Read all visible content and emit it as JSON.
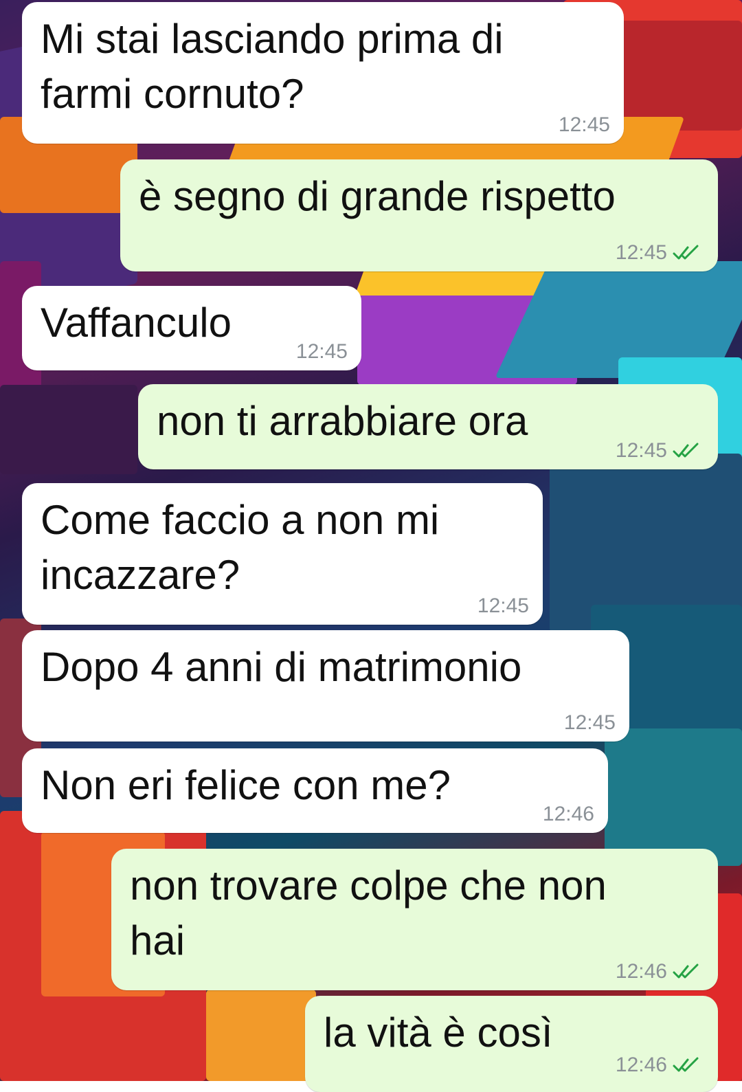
{
  "messages": [
    {
      "direction": "in",
      "text": "Mi stai lasciando prima di\nfarmi cornuto?",
      "time": "12:45"
    },
    {
      "direction": "out",
      "text": "è segno di grande rispetto",
      "time": "12:45",
      "status_icon": "double-check-icon"
    },
    {
      "direction": "in",
      "text": "Vaffanculo",
      "time": "12:45"
    },
    {
      "direction": "out",
      "text": "non ti arrabbiare ora",
      "time": "12:45",
      "status_icon": "double-check-icon"
    },
    {
      "direction": "in",
      "text": "Come faccio a non mi\nincazzare?",
      "time": "12:45"
    },
    {
      "direction": "in",
      "text": "Dopo 4 anni di matrimonio",
      "time": "12:45"
    },
    {
      "direction": "in",
      "text": "Non eri felice con me?",
      "time": "12:46"
    },
    {
      "direction": "out",
      "text": "non trovare colpe che non\nhai",
      "time": "12:46",
      "status_icon": "double-check-icon"
    },
    {
      "direction": "out",
      "text": "la vità è così",
      "time": "12:46",
      "status_icon": "double-check-icon"
    }
  ],
  "colors": {
    "incoming_bubble": "#ffffff",
    "outgoing_bubble": "#e7fbd9",
    "read_ticks": "#25a244",
    "timestamp": "#8a9096"
  }
}
